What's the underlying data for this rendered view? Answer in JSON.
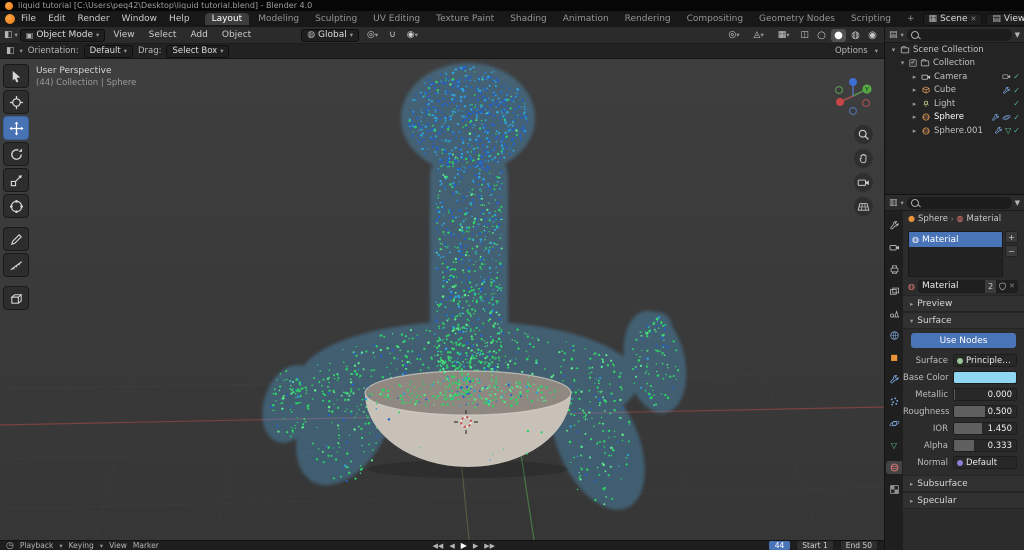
{
  "titlebar": {
    "title": "liquid tutorial [C:\\Users\\peq42\\Desktop\\liquid tutorial.blend] - Blender 4.0"
  },
  "menubar": {
    "menus": [
      "File",
      "Edit",
      "Render",
      "Window",
      "Help"
    ],
    "workspaces": [
      "Layout",
      "Modeling",
      "Sculpting",
      "UV Editing",
      "Texture Paint",
      "Shading",
      "Animation",
      "Rendering",
      "Compositing",
      "Geometry Nodes",
      "Scripting"
    ],
    "add_workspace": "+",
    "scene": "Scene",
    "view_layer": "ViewLayer"
  },
  "viewport_header": {
    "mode": "Object Mode",
    "menus": [
      "View",
      "Select",
      "Add",
      "Object"
    ],
    "orientation": "Global",
    "options": "Options"
  },
  "tool_settings": {
    "orientation_label": "Orientation:",
    "orientation_value": "Default",
    "drag_label": "Drag:",
    "drag_value": "Select Box"
  },
  "viewport": {
    "overlay_line1": "User Perspective",
    "overlay_line2": "(44) Collection | Sphere",
    "axis_y_label": "Y",
    "fluid": {
      "body": "#55aee6",
      "blue": "#2360cc",
      "cyan": "#2ea2d8",
      "green": "#2fd166",
      "green2": "#5ce88c",
      "bowl": "#c7c1b8"
    }
  },
  "outliner": {
    "root": "Scene Collection",
    "collection": "Collection",
    "items": [
      {
        "name": "Camera"
      },
      {
        "name": "Cube"
      },
      {
        "name": "Light"
      },
      {
        "name": "Sphere"
      },
      {
        "name": "Sphere.001"
      }
    ]
  },
  "properties": {
    "breadcrumb_object": "Sphere",
    "breadcrumb_data": "Material",
    "slot_name": "Material",
    "material_name": "Material",
    "users_count": "2",
    "preview_label": "Preview",
    "surface_label": "Surface",
    "use_nodes": "Use Nodes",
    "fields": [
      {
        "label": "Surface",
        "value": "Principled B"
      },
      {
        "label": "Base Color",
        "swatch": "#8fd6f2"
      },
      {
        "label": "Metallic",
        "value": "0.000",
        "frac": 0.02
      },
      {
        "label": "Roughness",
        "value": "0.500",
        "frac": 0.5
      },
      {
        "label": "IOR",
        "value": "1.450",
        "frac": 0.45
      },
      {
        "label": "Alpha",
        "value": "0.333",
        "frac": 0.33
      },
      {
        "label": "Normal",
        "value": "Default"
      }
    ],
    "subsurface_label": "Subsurface",
    "specular_label": "Specular"
  },
  "timeline": {
    "menus": [
      "Playback",
      "Keying",
      "View",
      "Marker"
    ],
    "current_frame": "44",
    "start_label": "Start",
    "start_value": "1",
    "end_label": "End",
    "end_value": "50"
  }
}
